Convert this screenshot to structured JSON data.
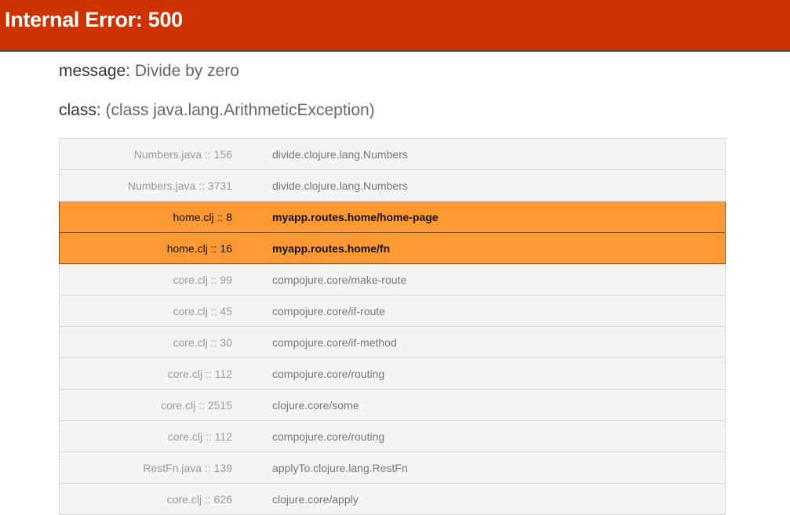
{
  "header": {
    "title": "Internal Error: 500"
  },
  "message": {
    "key": "message:",
    "value": "Divide by zero"
  },
  "class_info": {
    "key": "class:",
    "value": "(class java.lang.ArithmeticException)"
  },
  "colors": {
    "header_bg": "#cc3300",
    "app_frame_bg": "#ff9933",
    "lib_frame_bg": "#f4f4f4"
  },
  "trace": [
    {
      "file": "Numbers.java :: 156",
      "fn": "divide.clojure.lang.Numbers",
      "app": false
    },
    {
      "file": "Numbers.java :: 3731",
      "fn": "divide.clojure.lang.Numbers",
      "app": false
    },
    {
      "file": "home.clj :: 8",
      "fn": "myapp.routes.home/home-page",
      "app": true
    },
    {
      "file": "home.clj :: 16",
      "fn": "myapp.routes.home/fn",
      "app": true
    },
    {
      "file": "core.clj :: 99",
      "fn": "compojure.core/make-route",
      "app": false
    },
    {
      "file": "core.clj :: 45",
      "fn": "compojure.core/if-route",
      "app": false
    },
    {
      "file": "core.clj :: 30",
      "fn": "compojure.core/if-method",
      "app": false
    },
    {
      "file": "core.clj :: 112",
      "fn": "compojure.core/routing",
      "app": false
    },
    {
      "file": "core.clj :: 2515",
      "fn": "clojure.core/some",
      "app": false
    },
    {
      "file": "core.clj :: 112",
      "fn": "compojure.core/routing",
      "app": false
    },
    {
      "file": "RestFn.java :: 139",
      "fn": "applyTo.clojure.lang.RestFn",
      "app": false
    },
    {
      "file": "core.clj :: 626",
      "fn": "clojure.core/apply",
      "app": false
    }
  ]
}
